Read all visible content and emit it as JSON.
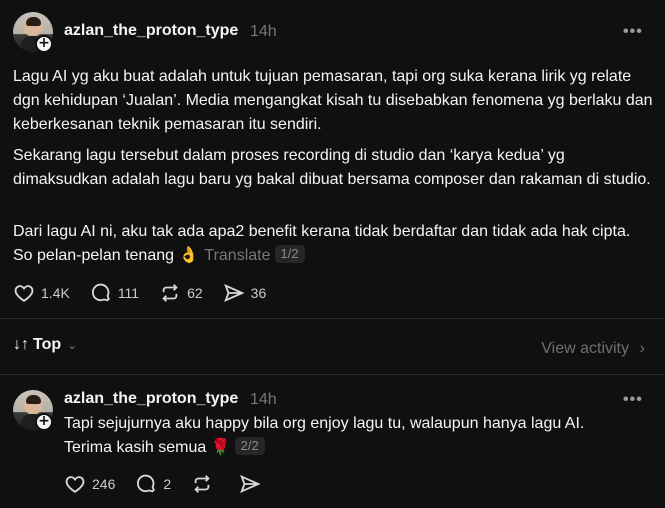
{
  "post1": {
    "username": "azlan_the_proton_type",
    "time": "14h",
    "more_label": "•••",
    "paragraphs": [
      "Lagu AI yg aku buat adalah untuk tujuan pemasaran, tapi org suka kerana lirik yg relate dgn kehidupan ‘Jualan’. Media mengangkat kisah tu disebabkan fenomena yg berlaku dan keberkesanan teknik pemasaran itu sendiri.",
      "Sekarang lagu tersebut dalam proses recording di studio dan ‘karya kedua’ yg dimaksudkan adalah lagu baru yg bakal dibuat bersama composer dan rakaman di studio.",
      "Dari lagu AI ni, aku tak ada apa2 benefit kerana tidak berdaftar dan tidak ada hak cipta. So pelan-pelan tenang 👌"
    ],
    "translate": "Translate",
    "pager": "1/2",
    "likes": "1.4K",
    "comments": "111",
    "reposts": "62",
    "shares": "36"
  },
  "sort": {
    "label": "Top",
    "icon": "↓↑",
    "view_activity": "View activity"
  },
  "post2": {
    "username": "azlan_the_proton_type",
    "time": "14h",
    "more_label": "•••",
    "text": "Tapi sejujurnya aku happy bila org enjoy lagu tu, walaupun hanya lagu AI. Terima kasih semua 🌹",
    "pager": "2/2",
    "likes": "246",
    "comments": "2"
  },
  "colors": {
    "background": "#101010",
    "text": "#f3f5f7",
    "muted": "#777777"
  }
}
